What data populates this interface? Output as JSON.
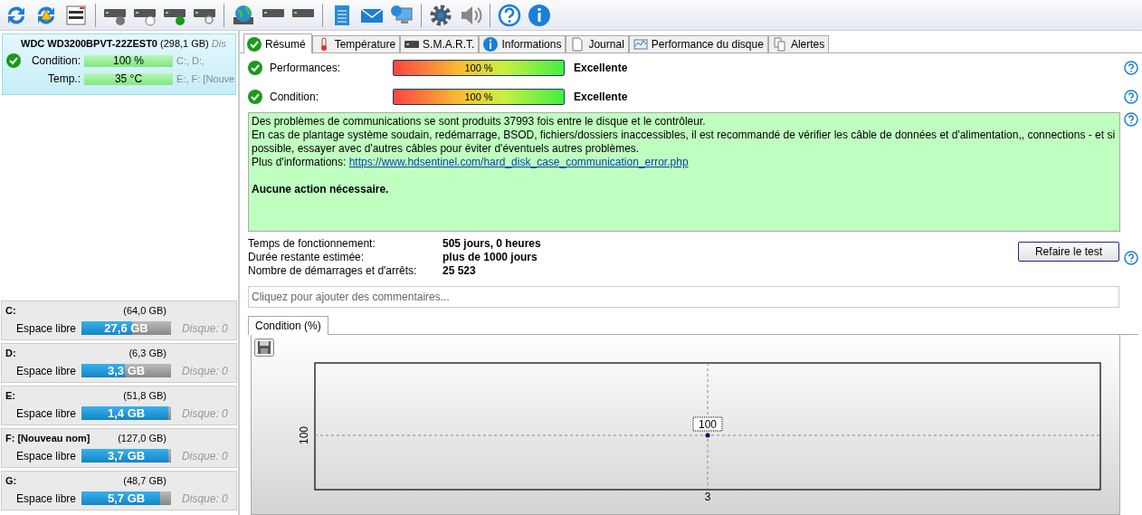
{
  "disk": {
    "name": "WDC WD3200BPVT-22ZEST0",
    "size": "(298,1 GB)",
    "cut_text": "Dis",
    "meters": [
      {
        "label": "Condition:",
        "value": "100 %",
        "level": 1,
        "drives": "C:, D:,"
      },
      {
        "label": "Temp.:",
        "value": "35 °C",
        "level": 1,
        "drives": "E:, F: [Nouve"
      }
    ]
  },
  "volumes": [
    {
      "name": "C:",
      "size": "(64,0 GB)",
      "free_label": "Espace libre",
      "free": "27,6 GB",
      "level": 0.57,
      "disk": "Disque: 0"
    },
    {
      "name": "D:",
      "size": "(6,3 GB)",
      "free_label": "Espace libre",
      "free": "3,3 GB",
      "level": 0.48,
      "disk": "Disque: 0"
    },
    {
      "name": "E:",
      "size": "(51,8 GB)",
      "free_label": "Espace libre",
      "free": "1,4 GB",
      "level": 0.97,
      "disk": "Disque: 0"
    },
    {
      "name": "F: [Nouveau nom]",
      "size": "(127,0 GB)",
      "free_label": "Espace libre",
      "free": "3,7 GB",
      "level": 0.97,
      "disk": "Disque: 0"
    },
    {
      "name": "G:",
      "size": "(48,7 GB)",
      "free_label": "Espace libre",
      "free": "5,7 GB",
      "level": 0.88,
      "disk": "Disque: 0"
    }
  ],
  "tabs": [
    {
      "label": "Résumé",
      "selected": true
    },
    {
      "label": "Température",
      "selected": false
    },
    {
      "label": "S.M.A.R.T.",
      "selected": false
    },
    {
      "label": "Informations",
      "selected": false
    },
    {
      "label": "Journal",
      "selected": false
    },
    {
      "label": "Performance du disque",
      "selected": false
    },
    {
      "label": "Alertes",
      "selected": false
    }
  ],
  "metrics": [
    {
      "label": "Performances:",
      "value": "100 %",
      "level": 1,
      "rating": "Excellente"
    },
    {
      "label": "Condition:",
      "value": "100 %",
      "level": 1,
      "rating": "Excellente"
    }
  ],
  "message": {
    "lines": [
      "Des problèmes de communications se sont produits 37993 fois entre le disque et le contrôleur.",
      "En cas de plantage système soudain, redémarrage, BSOD, fichiers/dossiers inaccessibles, il est recommandé de vérifier les câble de données et d'alimentation,, connections - et si possible, essayer avec d'autres câbles pour éviter d'éventuels autres problèmes."
    ],
    "link_prefix": "Plus d'informations:",
    "link": "https://www.hdsentinel.com/hard_disk_case_communication_error.php",
    "action": "Aucune action nécessaire."
  },
  "stats": [
    {
      "label": "Temps de fonctionnement:",
      "value": "505 jours, 0 heures"
    },
    {
      "label": "Durée restante estimée:",
      "value": "plus de 1000 jours"
    },
    {
      "label": "Nombre de démarrages et d'arrêts:",
      "value": "25 523"
    }
  ],
  "retest_button": "Refaire le test",
  "comments": {
    "placeholder": "Cliquez pour ajouter des commentaires..."
  },
  "chart_tabs": [
    {
      "label": "Condition (%)",
      "selected": true
    }
  ],
  "chart": {
    "y_label": "100",
    "x_label": "3",
    "point_label": "100"
  }
}
